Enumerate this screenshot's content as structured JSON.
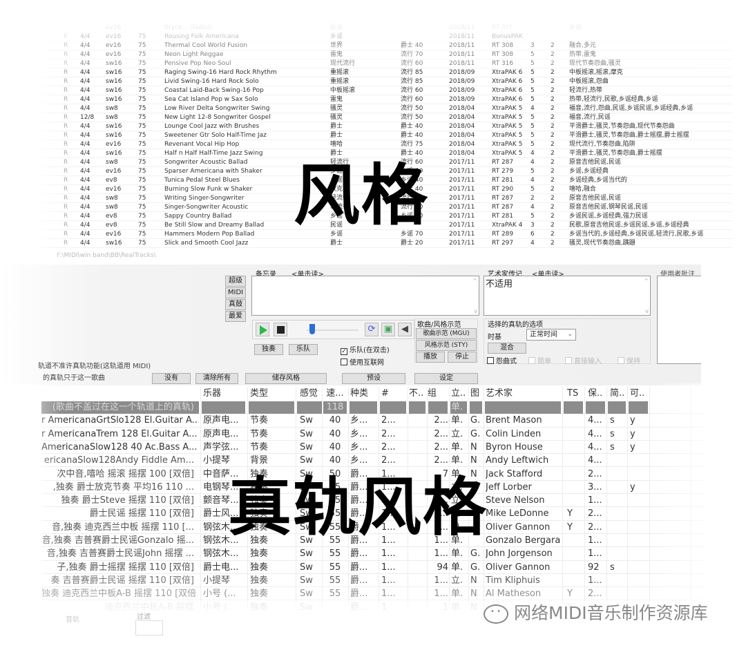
{
  "style_list": {
    "rows": [
      {
        "r": "",
        "ts": "",
        "feel": "ev16",
        "tempo": "",
        "name": "Bryce... (faded)",
        "genre": "民谣",
        "cat": "",
        "date": "2018/11",
        "set": "RT 3??",
        "a": "",
        "b": "",
        "tags": "乡谣"
      },
      {
        "r": "R",
        "ts": "4/4",
        "feel": "ev16",
        "tempo": "75",
        "name": "Rousing Folk Americana",
        "genre": "乡谣",
        "cat": "",
        "date": "2018/11",
        "set": "BonusPAK",
        "a": "",
        "b": "",
        "tags": ""
      },
      {
        "r": "R",
        "ts": "4/4",
        "feel": "ev16",
        "tempo": "75",
        "name": "Thermal Cool World Fusion",
        "genre": "世界",
        "cat": "爵士 40",
        "date": "2018/11",
        "set": "RT 308",
        "a": "3",
        "b": "2",
        "tags": "融合,多元"
      },
      {
        "r": "R",
        "ts": "4/4",
        "feel": "ev16",
        "tempo": "75",
        "name": "Neon Light Reggae",
        "genre": "雷鬼",
        "cat": "流行 70",
        "date": "2018/11",
        "set": "RT 308",
        "a": "5",
        "b": "2",
        "tags": "热带,雷鬼"
      },
      {
        "r": "R",
        "ts": "4/4",
        "feel": "sw16",
        "tempo": "75",
        "name": "Pensive Pop Neo Soul",
        "genre": "现代流行",
        "cat": "流行 60",
        "date": "2018/11",
        "set": "RT 316",
        "a": "5",
        "b": "2",
        "tags": "现代节奏怨曲,骚灵"
      },
      {
        "r": "R",
        "ts": "4/4",
        "feel": "sw16",
        "tempo": "75",
        "name": "Raging Swing-16 Hard Rock Rhythm",
        "genre": "重摇滚",
        "cat": "流行 85",
        "date": "2018/09",
        "set": "XtraPAK 6",
        "a": "5",
        "b": "2",
        "tags": "中板摇滚,摇滚,摩克"
      },
      {
        "r": "R",
        "ts": "4/4",
        "feel": "sw16",
        "tempo": "75",
        "name": "Livid Swing-16 Hard Rock Solo",
        "genre": "重摇滚",
        "cat": "流行 85",
        "date": "2018/09",
        "set": "XtraPAK 6",
        "a": "5",
        "b": "2",
        "tags": "中板摇滚,怨曲"
      },
      {
        "r": "R",
        "ts": "4/4",
        "feel": "sw16",
        "tempo": "75",
        "name": "Coastal Laid-Back Swing-16 Pop",
        "genre": "中板摇滚",
        "cat": "流行 60",
        "date": "2018/09",
        "set": "XtraPAK 6",
        "a": "5",
        "b": "2",
        "tags": "轻流行,热带"
      },
      {
        "r": "R",
        "ts": "4/4",
        "feel": "sw16",
        "tempo": "75",
        "name": "Sea Cat Island Pop w Sax Solo",
        "genre": "雷鬼",
        "cat": "流行 60",
        "date": "2018/09",
        "set": "XtraPAK 6",
        "a": "5",
        "b": "2",
        "tags": "热带,轻流行,民歌,乡谣经典,乡谣"
      },
      {
        "r": "R",
        "ts": "4/4",
        "feel": "sw8",
        "tempo": "75",
        "name": "Low River Delta Songwriter Swing",
        "genre": "骚灵",
        "cat": "流行 50",
        "date": "2018/04",
        "set": "XtraPAK 5",
        "a": "4",
        "b": "2",
        "tags": "福音,流行,怨曲,民谣,乡谣民谣,乡谣经典,乡谣"
      },
      {
        "r": "R",
        "ts": "12/8",
        "feel": "sw8",
        "tempo": "75",
        "name": "New Light 12-8 Songwriter Gospel",
        "genre": "骚灵",
        "cat": "流行 50",
        "date": "2018/04",
        "set": "XtraPAK 5",
        "a": "5",
        "b": "2",
        "tags": "福音,流行,民谣"
      },
      {
        "r": "R",
        "ts": "4/4",
        "feel": "sw16",
        "tempo": "75",
        "name": "Lounge Cool Jazz with Brushes",
        "genre": "爵士",
        "cat": "爵士 40",
        "date": "2018/04",
        "set": "XtraPAK 5",
        "a": "5",
        "b": "2",
        "tags": "平滑爵士,骚灵,节奏怨曲,现代节奏怨曲"
      },
      {
        "r": "R",
        "ts": "4/4",
        "feel": "sw16",
        "tempo": "75",
        "name": "Sweetener Gtr Solo Half-Time Jaz",
        "genre": "爵士",
        "cat": "爵士 40",
        "date": "2018/04",
        "set": "XtraPAK 5",
        "a": "5",
        "b": "2",
        "tags": "平滑爵士,骚灵,节奏怨曲,爵士摇摆,爵士摇摆"
      },
      {
        "r": "R",
        "ts": "4/4",
        "feel": "ev16",
        "tempo": "75",
        "name": "Revenant Vocal Hip Hop",
        "genre": "嘻哈",
        "cat": "流行 75",
        "date": "2018/04",
        "set": "XtraPAK 5",
        "a": "5",
        "b": "2",
        "tags": "现代流行,节奏怨曲,陷阱"
      },
      {
        "r": "R",
        "ts": "4/4",
        "feel": "sw16",
        "tempo": "75",
        "name": "Half n Half Half-Time Jazz Swing",
        "genre": "爵士",
        "cat": "爵士 40",
        "date": "2018/04",
        "set": "XtraPAK 5",
        "a": "4",
        "b": "2",
        "tags": "平滑爵士,骚灵,节奏怨曲,爵士摇摆"
      },
      {
        "r": "R",
        "ts": "4/4",
        "feel": "sw8",
        "tempo": "75",
        "name": "Songwriter Acoustic Ballad",
        "genre": "轻流行",
        "cat": "流行 60",
        "date": "2017/11",
        "set": "RT 287",
        "a": "4",
        "b": "2",
        "tags": "原音吉他民谣,民谣"
      },
      {
        "r": "R",
        "ts": "4/4",
        "feel": "ev16",
        "tempo": "75",
        "name": "Sparser Americana with Shaker",
        "genre": "乡谣",
        "cat": "乡谣 40",
        "date": "2017/11",
        "set": "RT 279",
        "a": "5",
        "b": "2",
        "tags": "乡谣,乡谣经典"
      },
      {
        "r": "R",
        "ts": "4/4",
        "feel": "ev8",
        "tempo": "75",
        "name": "Tunica Pedal Steel Blues",
        "genre": "乡谣",
        "cat": "乡谣 40",
        "date": "2017/11",
        "set": "RT 281",
        "a": "4",
        "b": "2",
        "tags": "乡谣经典,乡谣当代的"
      },
      {
        "r": "R",
        "ts": "4/4",
        "feel": "ev16",
        "tempo": "75",
        "name": "Burning Slow Funk w Shaker",
        "genre": "放克",
        "cat": "爵士 40",
        "date": "2017/11",
        "set": "RT 290",
        "a": "5",
        "b": "2",
        "tags": "嘻哈,融合"
      },
      {
        "r": "R",
        "ts": "4/4",
        "feel": "sw8",
        "tempo": "75",
        "name": "Writing Singer-Songwriter",
        "genre": "轻流行",
        "cat": "流行 60",
        "date": "2017/11",
        "set": "RT 287",
        "a": "2",
        "b": "2",
        "tags": "原音吉他民谣,民谣"
      },
      {
        "r": "R",
        "ts": "4/4",
        "feel": "sw8",
        "tempo": "75",
        "name": "Singer-Songwriter Acoustic",
        "genre": "轻流行",
        "cat": "流行 60",
        "date": "2017/11",
        "set": "RT 287",
        "a": "4",
        "b": "2",
        "tags": "原音吉他民谣,钢琴民谣,民谣"
      },
      {
        "r": "R",
        "ts": "4/4",
        "feel": "ev8",
        "tempo": "75",
        "name": "Sappy Country Ballad",
        "genre": "乡谣",
        "cat": "乡谣 40",
        "date": "2017/11",
        "set": "RT 281",
        "a": "5",
        "b": "2",
        "tags": "乡谣民谣,乡谣经典,强力民谣"
      },
      {
        "r": "R",
        "ts": "4/4",
        "feel": "ev8",
        "tempo": "75",
        "name": "Be Still Slow and Dreamy Ballad",
        "genre": "民谣",
        "cat": "",
        "date": "2017/11",
        "set": "XtraPAK 4",
        "a": "3",
        "b": "2",
        "tags": "民歌,原音吉他民谣,乡谣民谣,乡谣,乡谣经典"
      },
      {
        "r": "R",
        "ts": "4/4",
        "feel": "ev16",
        "tempo": "75",
        "name": "Hammers Modern Pop Ballad",
        "genre": "乡谣",
        "cat": "乡谣 70",
        "date": "2017/11",
        "set": "RT 289",
        "a": "6",
        "b": "2",
        "tags": "乡谣当代的,乡谣经典,乡谣民谣,轻流行,民歌,乡谣"
      },
      {
        "r": "R",
        "ts": "4/4",
        "feel": "sw16",
        "tempo": "75",
        "name": "Slick and Smooth Cool Jazz",
        "genre": "爵士",
        "cat": "爵士 20",
        "date": "2017/11",
        "set": "RT 297",
        "a": "4",
        "b": "2",
        "tags": "骚灵,现代节奏怨曲,蹒跚"
      }
    ],
    "path": "F:\\MIDI\\win band\\BB\\RealTracks\\"
  },
  "overlay": {
    "top_title": "风格",
    "bottom_title": "真轨风格"
  },
  "panel": {
    "side_buttons": [
      "超级",
      "MIDI",
      "真鼓",
      "最爱"
    ],
    "memo_label": "备忘录",
    "memo_hint": "<单击读>",
    "memo_text": "",
    "artist_bio_label": "艺术家传记",
    "artist_bio_hint": "<单击读>",
    "artist_bio_text": "不适用",
    "user_notes_label": "使用者批注",
    "transport": {
      "play_icon": "play-icon",
      "stop_icon": "stop-icon",
      "volume_level": 0.1,
      "loop_icon": "loop-icon",
      "image_icon": "picture-icon",
      "speaker_icon": "speaker-icon"
    },
    "solo_button": "独奏",
    "band_button": "乐队",
    "band_dblclick_checkbox": {
      "label": "乐队(在双击)",
      "checked": true
    },
    "use_internet_checkbox": {
      "label": "使用互联网",
      "checked": false
    },
    "demo_group": {
      "title": "歌曲/风格示范",
      "song_demo": "歌曲示范 (MGU)",
      "style_demo": "风格示范 (STY)",
      "play": "播放",
      "stop": "停止"
    },
    "options_group": {
      "title": "选择的真轨的选项",
      "timebase_label": "时基",
      "timebase_value": "正常时间",
      "mix_button": "混合",
      "checkboxes": [
        {
          "label": "怨曲式",
          "checked": false,
          "enabled": true
        },
        {
          "label": "简单",
          "checked": false,
          "enabled": false
        },
        {
          "label": "直接输入",
          "checked": false,
          "enabled": false
        },
        {
          "label": "保持",
          "checked": false,
          "enabled": false
        }
      ]
    },
    "left_note_1": "轨道不准许真轨功能(这轨道用 MIDI)",
    "left_note_2": "的真轨只于这一歌曲",
    "none_button": "没有",
    "clear_all_button": "清除所有",
    "save_style_button": "储存风格",
    "preset_button": "预设",
    "settings_button": "设定"
  },
  "track_table": {
    "headers": {
      "inst": "乐器",
      "type": "类型",
      "feel": "感觉",
      "tempo": "速...",
      "genre": "种类",
      "num": "#",
      "no": "不..",
      "grp": "组",
      "st": "立..",
      "img": "图",
      "artist": "艺术家",
      "ts": "TS",
      "keep": "保..",
      "simp": "简..",
      "can": "可.."
    },
    "rows": [
      {
        "name": "(歌曲不盖过在这一个轨道上的真轨)",
        "inst": "",
        "type": "",
        "feel": "",
        "tempo": "118",
        "genre": "",
        "num": "",
        "no": "",
        "grp": "",
        "st": "单.",
        "img": "",
        "artist": "",
        "ts": "",
        "keep": "",
        "simp": "",
        "can": "",
        "selected": true
      },
      {
        "name": "r AmericanaGrtSlo128 El.Guitar A...",
        "inst": "原声电...",
        "type": "节奏",
        "feel": "Sw",
        "tempo": "40",
        "genre": "乡...",
        "num": "2...",
        "no": "",
        "grp": "2...",
        "st": "单.",
        "img": "G.",
        "artist": "Brent Mason",
        "ts": "",
        "keep": "4...",
        "simp": "s",
        "can": "y"
      },
      {
        "name": "r AmericanaTrem 128 El.Guitar A...",
        "inst": "原声电...",
        "type": "节奏",
        "feel": "Sw",
        "tempo": "40",
        "genre": "乡...",
        "num": "2...",
        "no": "",
        "grp": "2...",
        "st": "立.",
        "img": "G.",
        "artist": "Colin Linden",
        "ts": "",
        "keep": "4...",
        "simp": "s",
        "can": "y"
      },
      {
        "name": "AmericanaSlow128 40 Ac.Bass A...",
        "inst": "声学弦...",
        "type": "节奏",
        "feel": "Sw",
        "tempo": "40",
        "genre": "乡...",
        "num": "2...",
        "no": "",
        "grp": "2...",
        "st": "单.",
        "img": "N",
        "artist": "Byron House",
        "ts": "",
        "keep": "4...",
        "simp": "s",
        "can": "y"
      },
      {
        "name": "ericanaSlow128Andy Fiddle Am...",
        "inst": "小提琴",
        "type": "背景",
        "feel": "Sw",
        "tempo": "40",
        "genre": "乡...",
        "num": "2...",
        "no": "",
        "grp": "2...",
        "st": "单.",
        "img": "N",
        "artist": "Andy Leftwich",
        "ts": "",
        "keep": "4...",
        "simp": "",
        "can": ""
      },
      {
        "name": "次中音,嘻哈 摇滚 摇摆 100 [双倍]",
        "inst": "中音萨...",
        "type": "独奏",
        "feel": "Sw",
        "tempo": "50",
        "genre": "爵...",
        "num": "1...",
        "no": "",
        "grp": "7",
        "st": "单.",
        "img": "N",
        "artist": "Jack Stafford",
        "ts": "",
        "keep": "2...",
        "simp": "",
        "can": ""
      },
      {
        "name": ",独奏 爵士放克节奏 平均16 110 ...",
        "inst": "电钢琴...",
        "type": "独奏",
        "feel": "Ev",
        "tempo": "55",
        "genre": "爵...",
        "num": "1...",
        "no": "",
        "grp": "1...",
        "st": "立.",
        "img": "",
        "artist": "Jeff Lorber",
        "ts": "",
        "keep": "3...",
        "simp": "",
        "can": "y"
      },
      {
        "name": "独奏 爵士Steve 摇摆 110 [双倍]",
        "inst": "颤音琴...",
        "type": "独奏",
        "feel": "Sw",
        "tempo": "55",
        "genre": "爵...",
        "num": "1...",
        "no": "",
        "grp": "1...",
        "st": "立.",
        "img": "",
        "artist": "Steve Nelson",
        "ts": "",
        "keep": "1...",
        "simp": "",
        "can": ""
      },
      {
        "name": "爵士民谣 摇摆 110 [双倍]",
        "inst": "爵士风...",
        "type": "独奏",
        "feel": "Sw",
        "tempo": "55",
        "genre": "爵...",
        "num": "1...",
        "no": "",
        "grp": "1...",
        "st": "立.",
        "img": "",
        "artist": "Mike LeDonne",
        "ts": "Y",
        "keep": "2...",
        "simp": "",
        "can": ""
      },
      {
        "name": "音,独奏 迪克西兰中板 摇摆 110 [...",
        "inst": "钢弦木...",
        "type": "独奏",
        "feel": "Sw",
        "tempo": "55",
        "genre": "爵...",
        "num": "1...",
        "no": "",
        "grp": "1...",
        "st": "单.",
        "img": "",
        "artist": "Oliver Gannon",
        "ts": "Y",
        "keep": "2...",
        "simp": "",
        "can": ""
      },
      {
        "name": "音,独奏 吉普赛爵士民谣Gonzalo 摇...",
        "inst": "钢弦木...",
        "type": "独奏",
        "feel": "Sw",
        "tempo": "55",
        "genre": "爵...",
        "num": "1...",
        "no": "",
        "grp": "1...",
        "st": "单.",
        "img": "",
        "artist": "Gonzalo Bergara",
        "ts": "",
        "keep": "1...",
        "simp": "",
        "can": ""
      },
      {
        "name": "音,独奏 吉普赛爵士民谣John 摇摆 ...",
        "inst": "钢弦木...",
        "type": "独奏",
        "feel": "Sw",
        "tempo": "55",
        "genre": "爵...",
        "num": "1...",
        "no": "",
        "grp": "1...",
        "st": "单.",
        "img": "G.",
        "artist": "John Jorgenson",
        "ts": "",
        "keep": "1...",
        "simp": "",
        "can": ""
      },
      {
        "name": "子,独奏 爵士摇摆 摇摆 110 [双倍]",
        "inst": "爵士电...",
        "type": "独奏",
        "feel": "Sw",
        "tempo": "55",
        "genre": "爵...",
        "num": "1...",
        "no": "",
        "grp": "94",
        "st": "单.",
        "img": "G.",
        "artist": "Oliver Gannon",
        "ts": "",
        "keep": "92",
        "simp": "s",
        "can": ""
      },
      {
        "name": "奏 吉普赛爵士民谣 摇摆 110 [双倍]",
        "inst": "小提琴",
        "type": "独奏",
        "feel": "Sw",
        "tempo": "55",
        "genre": "爵...",
        "num": "1...",
        "no": "",
        "grp": "1...",
        "st": "立.",
        "img": "N",
        "artist": "Tim Kliphuis",
        "ts": "",
        "keep": "1...",
        "simp": "",
        "can": ""
      },
      {
        "name": "独奏 迪克西兰中板A-B 摇摆 110 [双倍]",
        "inst": "小号 (...",
        "type": "独奏",
        "feel": "Sw",
        "tempo": "55",
        "genre": "爵...",
        "num": "1...",
        "no": "",
        "grp": "1...",
        "st": "单.",
        "img": "N",
        "artist": "Al Matheson",
        "ts": "Y",
        "keep": "2...",
        "simp": "",
        "can": ""
      },
      {
        "name": "迪克西兰中板A-B 摇摆",
        "inst": "小号 (...",
        "type": "独奏",
        "feel": "Sw",
        "tempo": "",
        "genre": "爵...",
        "num": "1",
        "no": "",
        "grp": "1",
        "st": "单.",
        "img": "N",
        "artist": "",
        "ts": "Y",
        "keep": "",
        "simp": "",
        "can": ""
      }
    ]
  },
  "footer": {
    "track_label": "音轨",
    "filter_label": "过滤",
    "watermark": "网络MIDI音乐制作资源库"
  }
}
